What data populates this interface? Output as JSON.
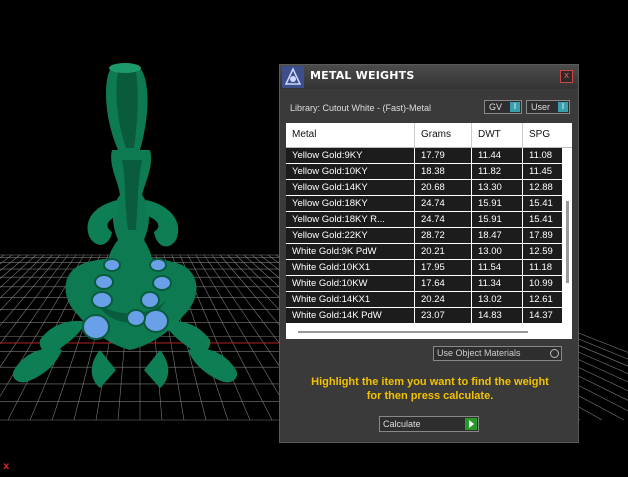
{
  "viewport": {
    "axis_label": "x",
    "colors": {
      "model": "#0d7a52",
      "gems": "#6aa0e8",
      "grid": "#8a8a8a",
      "x_axis": "#b02020"
    }
  },
  "dialog": {
    "title": "METAL WEIGHTS",
    "close_label": "x",
    "library_label": "Library: Cutout White - (Fast)-Metal",
    "toggle_gv": {
      "label": "GV",
      "knob": "I"
    },
    "toggle_user": {
      "label": "User",
      "knob": "I"
    },
    "table": {
      "columns": [
        "Metal",
        "Grams",
        "DWT",
        "SPG"
      ],
      "rows": [
        [
          "Yellow Gold:9KY",
          "17.79",
          "11.44",
          "11.08"
        ],
        [
          "Yellow Gold:10KY",
          "18.38",
          "11.82",
          "11.45"
        ],
        [
          "Yellow Gold:14KY",
          "20.68",
          "13.30",
          "12.88"
        ],
        [
          "Yellow Gold:18KY",
          "24.74",
          "15.91",
          "15.41"
        ],
        [
          "Yellow Gold:18KY R...",
          "24.74",
          "15.91",
          "15.41"
        ],
        [
          "Yellow Gold:22KY",
          "28.72",
          "18.47",
          "17.89"
        ],
        [
          "White Gold:9K PdW",
          "20.21",
          "13.00",
          "12.59"
        ],
        [
          "White Gold:10KX1",
          "17.95",
          "11.54",
          "11.18"
        ],
        [
          "White Gold:10KW",
          "17.64",
          "11.34",
          "10.99"
        ],
        [
          "White Gold:14KX1",
          "20.24",
          "13.02",
          "12.61"
        ],
        [
          "White Gold:14K PdW",
          "23.07",
          "14.83",
          "14.37"
        ]
      ]
    },
    "use_object_materials": "Use Object Materials",
    "hint_line1": "Highlight the item you want to find the weight",
    "hint_line2": "for then press calculate.",
    "calculate_label": "Calculate",
    "accent_color": "#f2c200"
  }
}
